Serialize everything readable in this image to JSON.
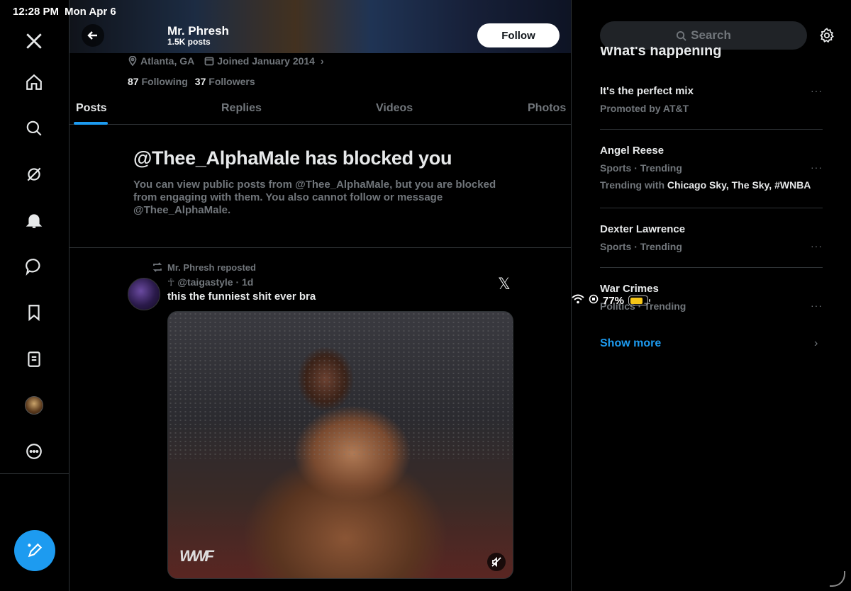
{
  "status": {
    "time": "12:28 PM",
    "date": "Mon Apr 6",
    "battery": "77%",
    "battery_level": 0.77
  },
  "nav": {
    "icons": [
      "x-logo-icon",
      "home-icon",
      "search-icon",
      "grok-icon",
      "bell-icon",
      "messages-icon",
      "bookmark-icon",
      "lists-icon",
      "profile-avatar",
      "more-icon"
    ],
    "compose_icon": "compose-icon"
  },
  "profile": {
    "name": "Mr. Phresh",
    "posts_count": "1.5K posts",
    "follow_label": "Follow",
    "location": "Atlanta, GA",
    "joined": "Joined January 2014",
    "following_count": "87",
    "following_label": "Following",
    "followers_count": "37",
    "followers_label": "Followers"
  },
  "tabs": [
    "Posts",
    "Replies",
    "Videos",
    "Photos"
  ],
  "blocked": {
    "title": "@Thee_AlphaMale has blocked you",
    "body": "You can view public posts from @Thee_AlphaMale, but you are blocked from engaging with them. You also cannot follow or message @Thee_AlphaMale."
  },
  "post": {
    "repost_by": "Mr. Phresh reposted",
    "handle": "☥ @taigastyle · 1d",
    "text": "this the funniest shit ever bra",
    "source_mark": "𝕏",
    "media_watermark": "WWF"
  },
  "sidebar": {
    "search_placeholder": "Search",
    "section_title": "What's happening",
    "trends": [
      {
        "name": "It's the perfect mix",
        "sub": "Promoted by AT&T"
      },
      {
        "name": "Angel Reese",
        "sub": "Sports · Trending",
        "with_prefix": "Trending with ",
        "with": "Chicago Sky, The Sky, #WNBA"
      },
      {
        "name": "Dexter Lawrence",
        "sub": "Sports · Trending"
      },
      {
        "name": "War Crimes",
        "sub": "Politics · Trending"
      }
    ],
    "show_more": "Show more"
  },
  "colors": {
    "accent": "#1d9bf0",
    "muted": "#71767b",
    "text": "#e7e9ea",
    "border": "#2f3336"
  }
}
